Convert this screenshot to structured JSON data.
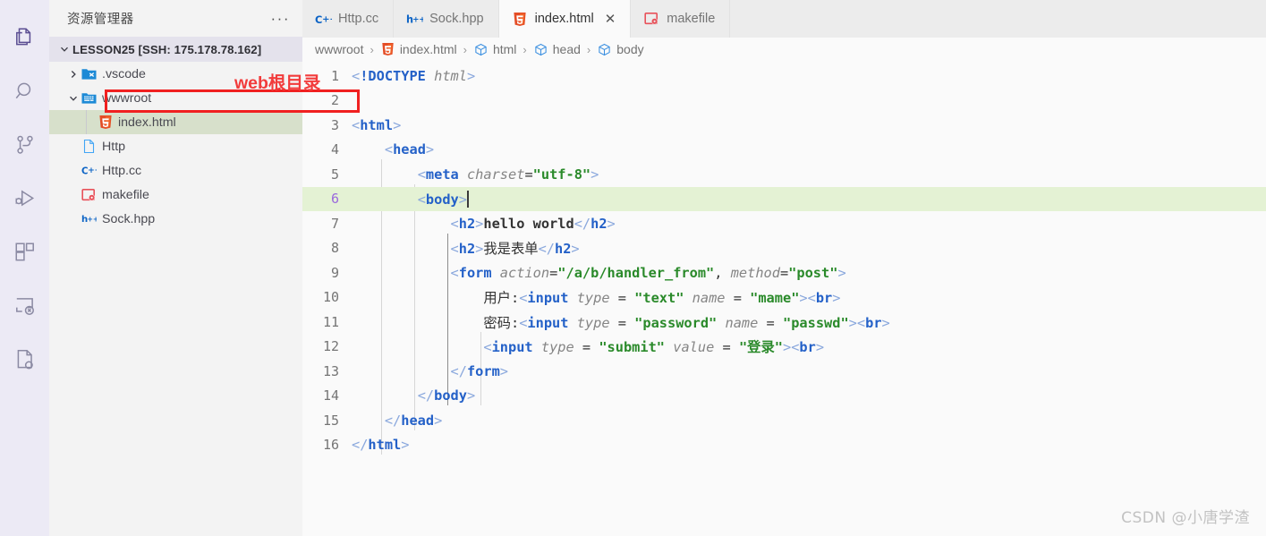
{
  "colors": {
    "accent_purple": "#5c4f93",
    "annotation_red": "#f02020",
    "selection_green": "#d7e0cb",
    "active_line_green": "#e4f2d4",
    "tag_blue": "#2461c8",
    "string_green": "#2a8a2a",
    "attr_gray": "#858585",
    "active_linenum_purple": "#9a69dd"
  },
  "activity_bar": {
    "items": [
      {
        "name": "explorer-icon",
        "title": "资源管理器",
        "active": true
      },
      {
        "name": "search-icon",
        "title": "搜索",
        "active": false
      },
      {
        "name": "source-control-icon",
        "title": "源代码管理",
        "active": false
      },
      {
        "name": "run-debug-icon",
        "title": "运行和调试",
        "active": false
      },
      {
        "name": "extensions-icon",
        "title": "扩展",
        "active": false
      },
      {
        "name": "remote-explorer-icon",
        "title": "远程资源管理器",
        "active": false
      },
      {
        "name": "cpp-tools-icon",
        "title": "C/C++",
        "active": false
      }
    ]
  },
  "sidebar": {
    "title": "资源管理器",
    "actions_label": "···",
    "root": {
      "label": "LESSON25 [SSH: 175.178.78.162]",
      "expanded": true
    },
    "items": [
      {
        "label": ".vscode",
        "icon": "vscode-folder-icon",
        "type": "folder",
        "depth": 1,
        "expanded": false,
        "selected": false
      },
      {
        "label": "wwwroot",
        "icon": "www-folder-icon",
        "type": "folder",
        "depth": 1,
        "expanded": true,
        "selected": false
      },
      {
        "label": "index.html",
        "icon": "html5-icon",
        "type": "file",
        "depth": 2,
        "selected": true
      },
      {
        "label": "Http",
        "icon": "plain-file-icon",
        "type": "file",
        "depth": 1,
        "selected": false
      },
      {
        "label": "Http.cc",
        "icon": "cpp-icon",
        "type": "file",
        "depth": 1,
        "selected": false
      },
      {
        "label": "makefile",
        "icon": "makefile-icon",
        "type": "file",
        "depth": 1,
        "selected": false
      },
      {
        "label": "Sock.hpp",
        "icon": "hpp-icon",
        "type": "file",
        "depth": 1,
        "selected": false
      }
    ]
  },
  "annotation": {
    "note_text": "web根目录",
    "target": "wwwroot"
  },
  "tabs": [
    {
      "label": "Http.cc",
      "icon": "cpp-icon",
      "active": false,
      "closable": false
    },
    {
      "label": "Sock.hpp",
      "icon": "hpp-icon",
      "active": false,
      "closable": false
    },
    {
      "label": "index.html",
      "icon": "html5-icon",
      "active": true,
      "closable": true,
      "close_label": "✕"
    },
    {
      "label": "makefile",
      "icon": "makefile-icon",
      "active": false,
      "closable": false
    }
  ],
  "breadcrumb": {
    "separator": "›",
    "items": [
      {
        "label": "wwwroot",
        "icon": "none"
      },
      {
        "label": "index.html",
        "icon": "html5-icon"
      },
      {
        "label": "html",
        "icon": "symbol-cube-icon"
      },
      {
        "label": "head",
        "icon": "symbol-cube-icon"
      },
      {
        "label": "body",
        "icon": "symbol-cube-icon"
      }
    ]
  },
  "editor": {
    "language": "html",
    "active_line": 6,
    "cursor_after": "<body>",
    "lines": [
      {
        "n": 1,
        "tokens": [
          {
            "t": "punc",
            "v": "<"
          },
          {
            "t": "doct",
            "v": "!DOCTYPE "
          },
          {
            "t": "docv",
            "v": "html"
          },
          {
            "t": "punc",
            "v": ">"
          }
        ]
      },
      {
        "n": 2,
        "tokens": []
      },
      {
        "n": 3,
        "tokens": [
          {
            "t": "punc",
            "v": "<"
          },
          {
            "t": "tag",
            "v": "html"
          },
          {
            "t": "punc",
            "v": ">"
          }
        ]
      },
      {
        "n": 4,
        "tokens": [
          {
            "t": "plain",
            "v": "    "
          },
          {
            "t": "punc",
            "v": "<"
          },
          {
            "t": "tag",
            "v": "head"
          },
          {
            "t": "punc",
            "v": ">"
          }
        ]
      },
      {
        "n": 5,
        "tokens": [
          {
            "t": "plain",
            "v": "        "
          },
          {
            "t": "punc",
            "v": "<"
          },
          {
            "t": "tag",
            "v": "meta"
          },
          {
            "t": "plain",
            "v": " "
          },
          {
            "t": "attr",
            "v": "charset"
          },
          {
            "t": "eq",
            "v": "="
          },
          {
            "t": "str",
            "v": "\"utf-8\""
          },
          {
            "t": "punc",
            "v": ">"
          }
        ]
      },
      {
        "n": 6,
        "tokens": [
          {
            "t": "plain",
            "v": "        "
          },
          {
            "t": "punc",
            "v": "<"
          },
          {
            "t": "tag",
            "v": "body"
          },
          {
            "t": "punc",
            "v": ">"
          },
          {
            "t": "cursor",
            "v": ""
          }
        ]
      },
      {
        "n": 7,
        "tokens": [
          {
            "t": "plain",
            "v": "            "
          },
          {
            "t": "punc",
            "v": "<"
          },
          {
            "t": "tag",
            "v": "h2"
          },
          {
            "t": "punc",
            "v": ">"
          },
          {
            "t": "text",
            "v": "hello world"
          },
          {
            "t": "punc",
            "v": "</"
          },
          {
            "t": "tag",
            "v": "h2"
          },
          {
            "t": "punc",
            "v": ">"
          }
        ]
      },
      {
        "n": 8,
        "tokens": [
          {
            "t": "plain",
            "v": "            "
          },
          {
            "t": "punc",
            "v": "<"
          },
          {
            "t": "tag",
            "v": "h2"
          },
          {
            "t": "punc",
            "v": ">"
          },
          {
            "t": "cjk",
            "v": "我是表单"
          },
          {
            "t": "punc",
            "v": "</"
          },
          {
            "t": "tag",
            "v": "h2"
          },
          {
            "t": "punc",
            "v": ">"
          }
        ]
      },
      {
        "n": 9,
        "tokens": [
          {
            "t": "plain",
            "v": "            "
          },
          {
            "t": "punc",
            "v": "<"
          },
          {
            "t": "tag",
            "v": "form"
          },
          {
            "t": "plain",
            "v": " "
          },
          {
            "t": "attr",
            "v": "action"
          },
          {
            "t": "eq",
            "v": "="
          },
          {
            "t": "str",
            "v": "\"/a/b/handler_from\""
          },
          {
            "t": "eq",
            "v": ", "
          },
          {
            "t": "attr",
            "v": "method"
          },
          {
            "t": "eq",
            "v": "="
          },
          {
            "t": "str",
            "v": "\"post\""
          },
          {
            "t": "punc",
            "v": ">"
          }
        ]
      },
      {
        "n": 10,
        "tokens": [
          {
            "t": "plain",
            "v": "                "
          },
          {
            "t": "cjk",
            "v": "用户"
          },
          {
            "t": "eq",
            "v": ":"
          },
          {
            "t": "punc",
            "v": "<"
          },
          {
            "t": "tag",
            "v": "input"
          },
          {
            "t": "plain",
            "v": " "
          },
          {
            "t": "attr",
            "v": "type"
          },
          {
            "t": "eq",
            "v": " = "
          },
          {
            "t": "str",
            "v": "\"text\""
          },
          {
            "t": "plain",
            "v": " "
          },
          {
            "t": "attr",
            "v": "name"
          },
          {
            "t": "eq",
            "v": " = "
          },
          {
            "t": "str",
            "v": "\"mame\""
          },
          {
            "t": "punc",
            "v": ">"
          },
          {
            "t": "punc",
            "v": "<"
          },
          {
            "t": "tag",
            "v": "br"
          },
          {
            "t": "punc",
            "v": ">"
          }
        ]
      },
      {
        "n": 11,
        "tokens": [
          {
            "t": "plain",
            "v": "                "
          },
          {
            "t": "cjk",
            "v": "密码"
          },
          {
            "t": "eq",
            "v": ":"
          },
          {
            "t": "punc",
            "v": "<"
          },
          {
            "t": "tag",
            "v": "input"
          },
          {
            "t": "plain",
            "v": " "
          },
          {
            "t": "attr",
            "v": "type"
          },
          {
            "t": "eq",
            "v": " = "
          },
          {
            "t": "str",
            "v": "\"password\""
          },
          {
            "t": "plain",
            "v": " "
          },
          {
            "t": "attr",
            "v": "name"
          },
          {
            "t": "eq",
            "v": " = "
          },
          {
            "t": "str",
            "v": "\"passwd\""
          },
          {
            "t": "punc",
            "v": ">"
          },
          {
            "t": "punc",
            "v": "<"
          },
          {
            "t": "tag",
            "v": "br"
          },
          {
            "t": "punc",
            "v": ">"
          }
        ]
      },
      {
        "n": 12,
        "tokens": [
          {
            "t": "plain",
            "v": "                "
          },
          {
            "t": "punc",
            "v": "<"
          },
          {
            "t": "tag",
            "v": "input"
          },
          {
            "t": "plain",
            "v": " "
          },
          {
            "t": "attr",
            "v": "type"
          },
          {
            "t": "eq",
            "v": " = "
          },
          {
            "t": "str",
            "v": "\"submit\""
          },
          {
            "t": "plain",
            "v": " "
          },
          {
            "t": "attr",
            "v": "value"
          },
          {
            "t": "eq",
            "v": " = "
          },
          {
            "t": "str",
            "v": "\"登录\""
          },
          {
            "t": "punc",
            "v": ">"
          },
          {
            "t": "punc",
            "v": "<"
          },
          {
            "t": "tag",
            "v": "br"
          },
          {
            "t": "punc",
            "v": ">"
          }
        ]
      },
      {
        "n": 13,
        "tokens": [
          {
            "t": "plain",
            "v": "            "
          },
          {
            "t": "punc",
            "v": "</"
          },
          {
            "t": "tag",
            "v": "form"
          },
          {
            "t": "punc",
            "v": ">"
          }
        ]
      },
      {
        "n": 14,
        "tokens": [
          {
            "t": "plain",
            "v": "        "
          },
          {
            "t": "punc",
            "v": "</"
          },
          {
            "t": "tag",
            "v": "body"
          },
          {
            "t": "punc",
            "v": ">"
          }
        ]
      },
      {
        "n": 15,
        "tokens": [
          {
            "t": "plain",
            "v": "    "
          },
          {
            "t": "punc",
            "v": "</"
          },
          {
            "t": "tag",
            "v": "head"
          },
          {
            "t": "punc",
            "v": ">"
          }
        ]
      },
      {
        "n": 16,
        "tokens": [
          {
            "t": "punc",
            "v": "</"
          },
          {
            "t": "tag",
            "v": "html"
          },
          {
            "t": "punc",
            "v": ">"
          }
        ]
      }
    ]
  },
  "watermark": {
    "text": "CSDN @小唐学渣"
  }
}
